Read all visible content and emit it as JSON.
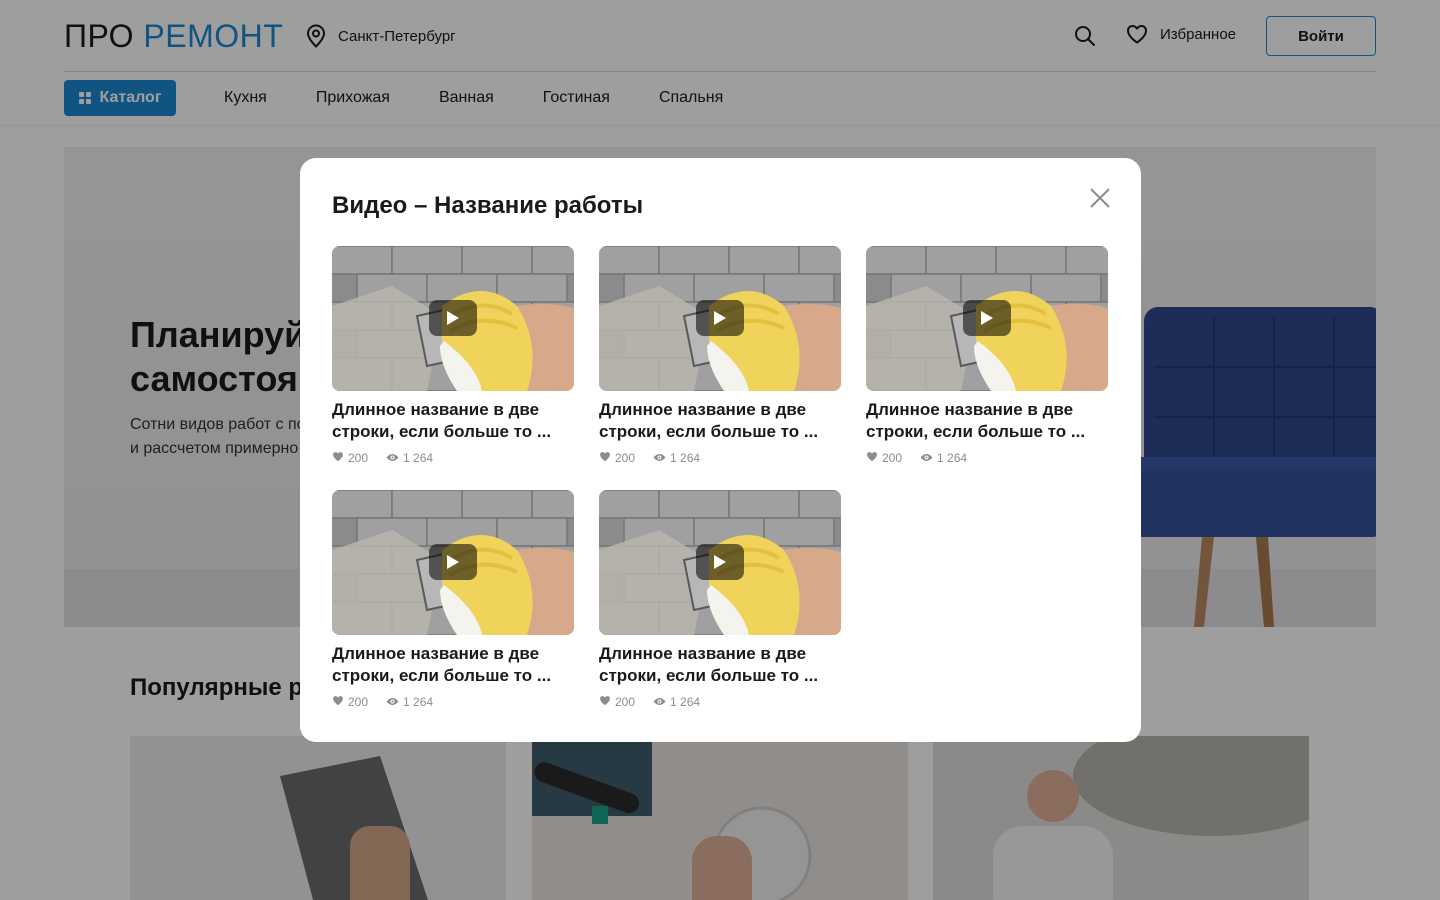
{
  "header": {
    "logo_pre": "ПРО",
    "logo_brand": "РЕМОНТ",
    "city": "Санкт-Петербург",
    "favorites_label": "Избранное",
    "login_label": "Войти",
    "icons": {
      "location": "location-pin-icon",
      "search": "search-icon",
      "favorites": "heart-icon"
    }
  },
  "nav": {
    "catalog_label": "Каталог",
    "links": [
      "Кухня",
      "Прихожая",
      "Ванная",
      "Гостиная",
      "Спальня"
    ]
  },
  "hero": {
    "title_line1": "Планируй",
    "title_line2": "самостоя",
    "subtitle_line1": "Сотни видов работ с по",
    "subtitle_line2": "и рассчетом примерно"
  },
  "popular": {
    "title": "Популярные р"
  },
  "modal": {
    "title": "Видео – Название работы",
    "close_icon": "close-icon",
    "videos": [
      {
        "title": "Длинное название в две строки, если больше то ...",
        "likes": "200",
        "views": "1 264"
      },
      {
        "title": "Длинное название в две строки, если больше то ...",
        "likes": "200",
        "views": "1 264"
      },
      {
        "title": "Длинное название в две строки, если больше то ...",
        "likes": "200",
        "views": "1 264"
      },
      {
        "title": "Длинное название в две строки, если больше то ...",
        "likes": "200",
        "views": "1 264"
      },
      {
        "title": "Длинное название в две строки, если больше то ...",
        "likes": "200",
        "views": "1 264"
      }
    ]
  },
  "colors": {
    "accent": "#1a8ad0",
    "overlay": "rgba(0,0,0,0.38)",
    "stat_text": "#8c8c8c",
    "sofa": "#2f4a8f"
  }
}
